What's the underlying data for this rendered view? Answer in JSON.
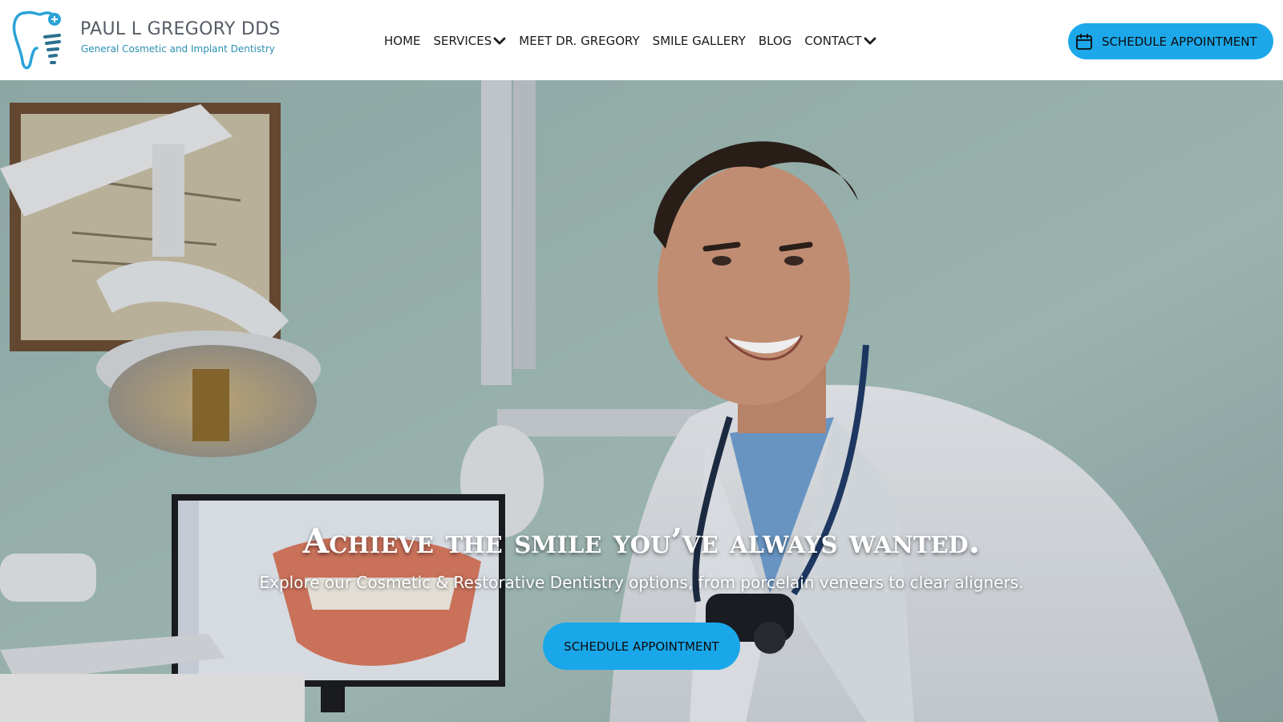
{
  "header": {
    "logo": {
      "name": "PAUL L GREGORY DDS",
      "tagline": "General Cosmetic and Implant Dentistry",
      "icon": "tooth-implant-icon"
    },
    "nav": [
      {
        "label": "HOME",
        "dropdown": false
      },
      {
        "label": "SERVICES",
        "dropdown": true
      },
      {
        "label": "MEET DR. GREGORY",
        "dropdown": false
      },
      {
        "label": "SMILE GALLERY",
        "dropdown": false
      },
      {
        "label": "BLOG",
        "dropdown": false
      },
      {
        "label": "CONTACT",
        "dropdown": true
      }
    ],
    "cta": {
      "label": "SCHEDULE APPOINTMENT",
      "icon": "calendar-icon"
    }
  },
  "hero": {
    "headline": "Achieve the smile you’ve always wanted.",
    "subheadline": "Explore our Cosmetic & Restorative Dentistry options, from porcelain veneers to clear aligners.",
    "cta_label": "SCHEDULE APPOINTMENT",
    "background": "photo-dentist-smiling-in-operatory"
  },
  "colors": {
    "accent": "#1da8ea",
    "logo_blue": "#2b8fb3",
    "logo_text": "#555c66",
    "nav_text": "#1b1b1b",
    "header_bg": "#ffffff"
  }
}
